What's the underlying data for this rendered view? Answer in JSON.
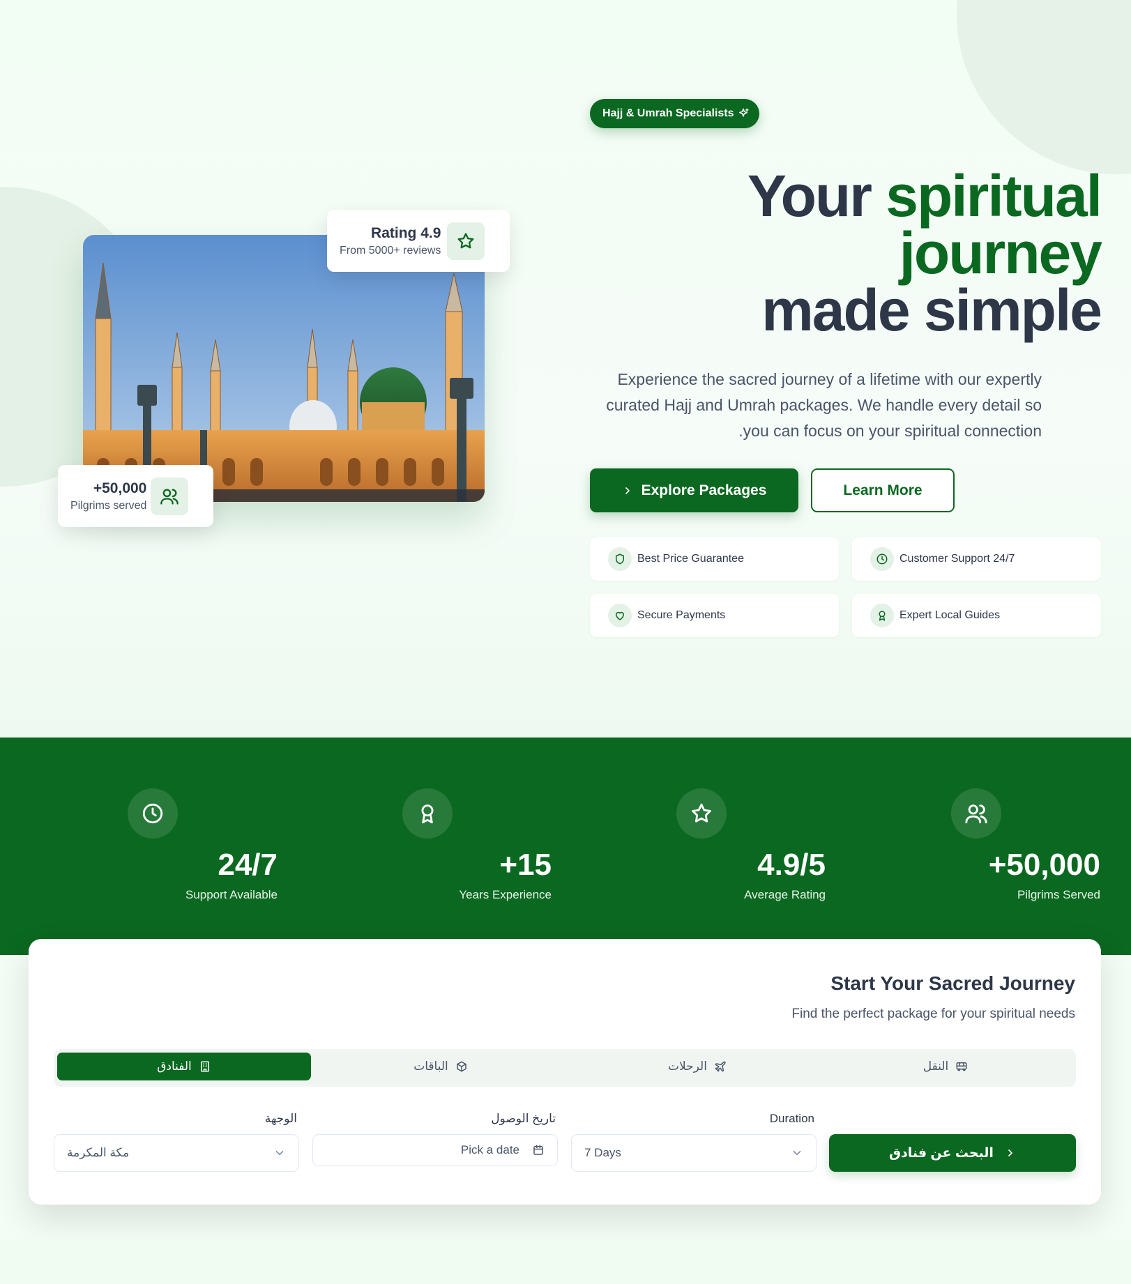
{
  "colors": {
    "brand": "#0b6820",
    "text_dark": "#2d3748",
    "text_muted": "#4a5568",
    "tint": "#e4f1e6"
  },
  "hero": {
    "badge": "Hajj & Umrah Specialists",
    "headline": {
      "w1": "Your",
      "w2": "spiritual",
      "w3": "journey",
      "w4": "made",
      "w5": "simple"
    },
    "description": "Experience the sacred journey of a lifetime with our expertly curated Hajj and Umrah packages. We handle every detail so .you can focus on your spiritual connection",
    "primary_button": "Explore Packages",
    "secondary_button": "Learn More",
    "features": [
      {
        "label": "Best Price Guarantee",
        "icon": "shield-icon"
      },
      {
        "label": "Customer Support 24/7",
        "icon": "clock-icon"
      },
      {
        "label": "Secure Payments",
        "icon": "heart-icon"
      },
      {
        "label": "Expert Local Guides",
        "icon": "award-icon"
      }
    ],
    "rating_card": {
      "title": "Rating 4.9",
      "subtitle": "From 5000+ reviews",
      "icon": "star-icon"
    },
    "pilgrims_card": {
      "title": "+50,000",
      "subtitle": "Pilgrims served",
      "icon": "users-icon"
    }
  },
  "stats": [
    {
      "value": "24/7",
      "label": "Support Available",
      "icon": "clock-icon"
    },
    {
      "value": "+15",
      "label": "Years Experience",
      "icon": "award-icon"
    },
    {
      "value": "4.9/5",
      "label": "Average Rating",
      "icon": "star-icon"
    },
    {
      "value": "+50,000",
      "label": "Pilgrims Served",
      "icon": "users-icon"
    }
  ],
  "search": {
    "title": "Start Your Sacred Journey",
    "subtitle": "Find the perfect package for your spiritual needs",
    "tabs": [
      {
        "label": "الفنادق",
        "icon": "hotel-icon",
        "active": true
      },
      {
        "label": "الباقات",
        "icon": "package-icon",
        "active": false
      },
      {
        "label": "الرحلات",
        "icon": "plane-icon",
        "active": false
      },
      {
        "label": "النقل",
        "icon": "bus-icon",
        "active": false
      }
    ],
    "destination": {
      "label": "الوجهة",
      "value": "مكة المكرمة"
    },
    "arrival": {
      "label": "تاريخ الوصول",
      "placeholder": "Pick a date"
    },
    "duration": {
      "label": "Duration",
      "value": "7 Days"
    },
    "button": "البحث عن فنادق"
  }
}
